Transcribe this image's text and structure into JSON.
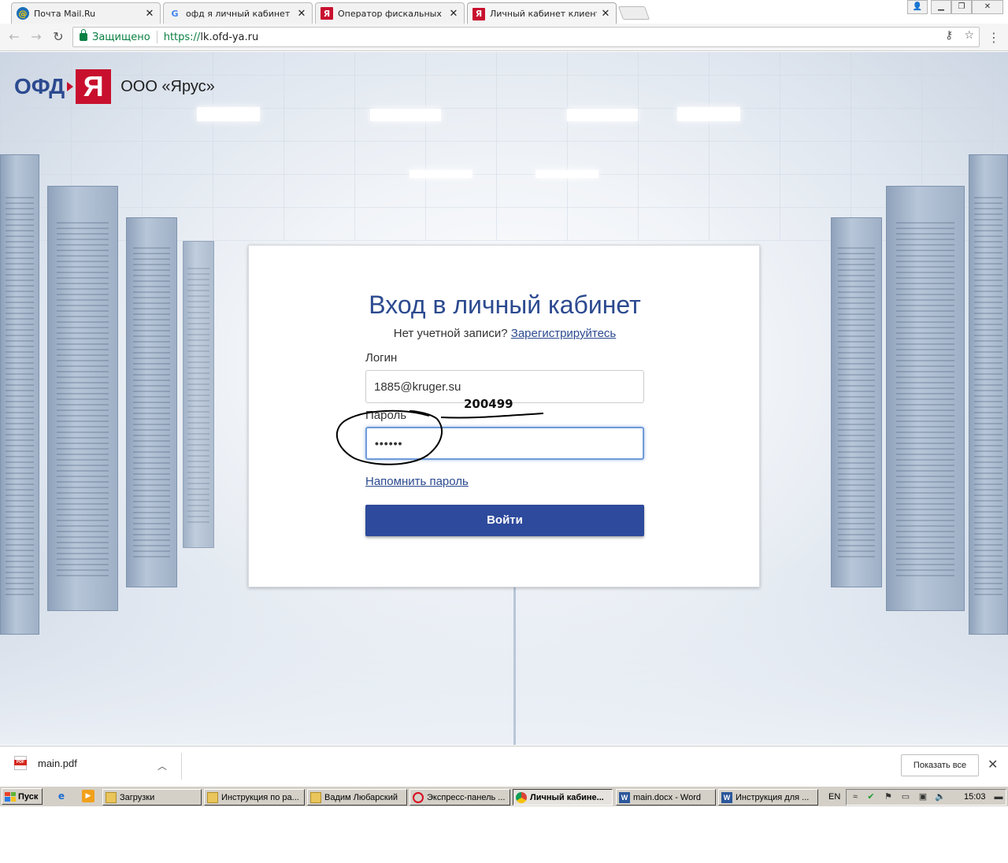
{
  "browser": {
    "tabs": [
      {
        "title": "Почта Mail.Ru",
        "icon": "mail-ru-icon",
        "active": false
      },
      {
        "title": "офд я личный кабинет - П",
        "icon": "google-icon",
        "active": false
      },
      {
        "title": "Оператор фискальных да",
        "icon": "ofd-ya-icon",
        "active": false
      },
      {
        "title": "Личный кабинет клиента",
        "icon": "ofd-ya-icon",
        "active": true
      }
    ],
    "address_bar": {
      "secure_label": "Защищено",
      "url_scheme": "https://",
      "url_host": "lk.ofd-ya.ru"
    }
  },
  "page": {
    "logo": {
      "ofd_text": "ОФД",
      "ya_text": "Я",
      "company": "ООО «Ярус»",
      "brand_red": "#c8102e",
      "brand_blue": "#2c4a8f"
    },
    "login_form": {
      "title": "Вход в личный кабинет",
      "no_account_text": "Нет учетной записи?",
      "register_link": "Зарегистрируйтесь",
      "login_label": "Логин",
      "login_value": "1885@kruger.su",
      "password_label": "Пароль",
      "password_value": "••••••",
      "remind_link": "Напомнить пароль",
      "submit_label": "Войти",
      "button_color": "#2e4a9c"
    },
    "annotation": {
      "handwritten_text": "200499"
    }
  },
  "downloads": {
    "file_name": "main.pdf",
    "show_all_label": "Показать все"
  },
  "taskbar": {
    "start_label": "Пуск",
    "tasks": [
      {
        "label": "Загрузки",
        "icon": "folder-icon",
        "active": false
      },
      {
        "label": "Инструкция по ра...",
        "icon": "folder-icon",
        "active": false
      },
      {
        "label": "Вадим Любарский",
        "icon": "folder-icon",
        "active": false
      },
      {
        "label": "Экспресс-панель ...",
        "icon": "opera-icon",
        "active": false
      },
      {
        "label": "Личный кабине...",
        "icon": "chrome-icon",
        "active": true
      },
      {
        "label": "main.docx - Word",
        "icon": "word-icon",
        "active": false
      },
      {
        "label": "Инструкция для ...",
        "icon": "word-icon",
        "active": false
      }
    ],
    "language": "EN",
    "clock": "15:03"
  }
}
